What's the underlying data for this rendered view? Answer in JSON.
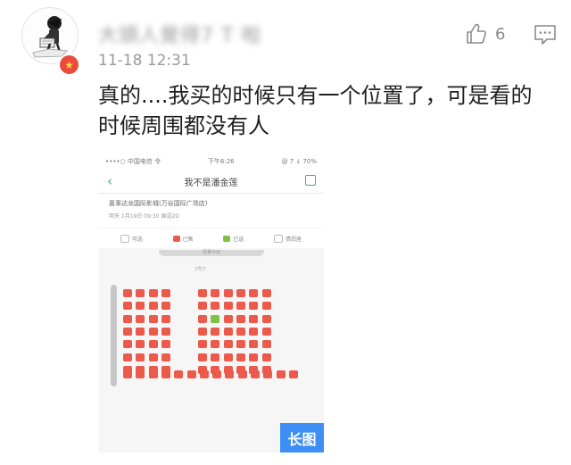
{
  "comment": {
    "username": "大頭人覺得7 T 啦",
    "time": "11-18 12:31",
    "text": "真的....我买的时候只有一个位置了，可是看的时候周围都没有人",
    "likes": "6",
    "avatar_icon": "cartoon-avatar",
    "badge_icon": "star-badge",
    "like_icon": "thumbs-up-icon",
    "reply_icon": "comment-icon"
  },
  "attachment": {
    "status_carrier": "••••○ 中国电信 令",
    "status_time": "下午6:26",
    "status_battery": "@ 7 ↓ 70%",
    "nav_title": "我不是潘金莲",
    "cinema_name": "嘉事达龙国际影城(万谷国际广场店)",
    "show_time": "明天 1月19日 09:30 国语2D",
    "legend": [
      "可选",
      "已售",
      "已选",
      "情侣座"
    ],
    "screen_label": "屏幕中央",
    "hall_label": "3号厅",
    "badge_label": "长图",
    "colors": {
      "sold": "#ec5a4b",
      "selected": "#7ec243",
      "accent": "#40b35a"
    }
  }
}
